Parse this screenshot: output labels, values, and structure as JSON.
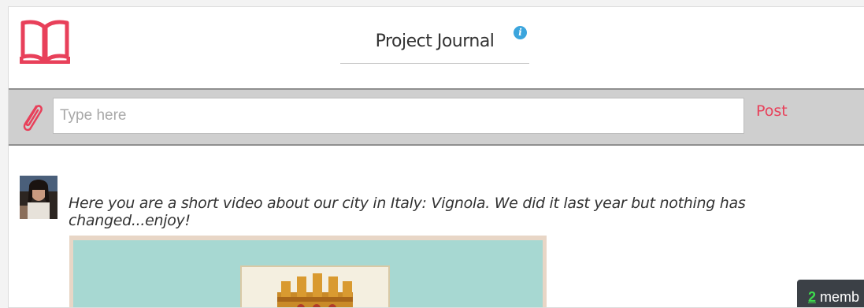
{
  "header": {
    "title": "Project Journal",
    "info_icon": "info-icon",
    "logo_icon": "open-book-icon"
  },
  "composer": {
    "attach_icon": "paperclip-icon",
    "placeholder": "Type here",
    "value": "",
    "post_label": "Post"
  },
  "post": {
    "avatar_icon": "user-avatar",
    "text": "Here you are a short video about our city in Italy: Vignola. We did it last year but nothing has changed...enjoy!",
    "video_thumbnail": "video-thumbnail"
  },
  "members_badge": {
    "count": "2",
    "label": " memb"
  },
  "colors": {
    "accent": "#e8405a",
    "info": "#3ba5dd",
    "composer_bg": "#cfcfcf",
    "members_bg": "#3b4046",
    "members_count": "#3ddc4d"
  }
}
